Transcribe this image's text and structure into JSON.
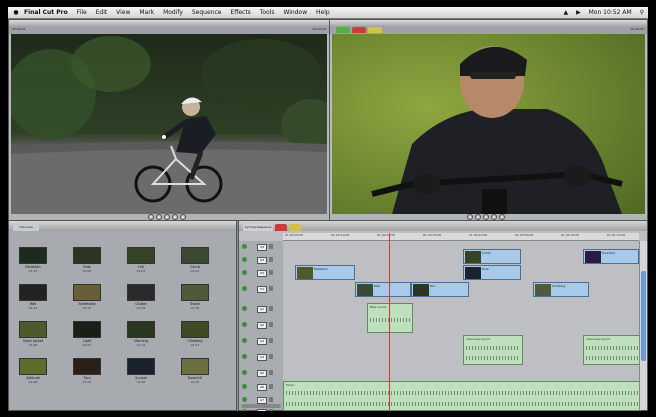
{
  "menubar": {
    "apple": "",
    "items": [
      "Final Cut Pro",
      "File",
      "Edit",
      "View",
      "Mark",
      "Modify",
      "Sequence",
      "Effects",
      "Tools",
      "Window",
      "Help"
    ],
    "clock": "Mon 10:52 AM"
  },
  "viewer_left": {
    "timecode_left": "00:00:01",
    "timecode_right": "00:00:09"
  },
  "canvas_right": {
    "timecode_left": "00:00:04",
    "timecode_right": "00:00:02"
  },
  "browser": {
    "tab_label": "Interview",
    "clips": [
      {
        "name": "Establish",
        "dur": "01:13"
      },
      {
        "name": "Ride",
        "dur": "01:05"
      },
      {
        "name": "Hill",
        "dur": "01:02"
      },
      {
        "name": "Climb",
        "dur": "01:01"
      },
      {
        "name": "Wet",
        "dur": "01:03"
      },
      {
        "name": "Streetside",
        "dur": "01:12"
      },
      {
        "name": "Clutter",
        "dur": "01:03"
      },
      {
        "name": "Travel",
        "dur": "01:08"
      },
      {
        "name": "Open Jacket",
        "dur": "01:08"
      },
      {
        "name": "Light",
        "dur": "01:01"
      },
      {
        "name": "Morning",
        "dur": "01:12"
      },
      {
        "name": "Climbing",
        "dur": "01:07"
      },
      {
        "name": "Attitude",
        "dur": "01:08"
      },
      {
        "name": "Turn",
        "dur": "01:02"
      },
      {
        "name": "Sunset",
        "dur": "01:08"
      },
      {
        "name": "Downhill",
        "dur": "01:10"
      }
    ]
  },
  "timeline": {
    "title": "Cycling Sequence",
    "ruler": [
      "01:00:00:00",
      "01:00:10:00",
      "01:00:20:00",
      "01:00:30:00",
      "01:00:40:00",
      "01:00:50:00",
      "01:01:00:00",
      "01:01:10:00"
    ],
    "tracks": [
      "V4",
      "V3",
      "V2",
      "V1",
      "A1",
      "A2",
      "A3",
      "A4",
      "A5",
      "A6",
      "A7",
      "A8"
    ],
    "video_clips": [
      "Establish",
      "Wet",
      "Climb",
      "Ride",
      "Hill",
      "Downhill",
      "Climbing"
    ],
    "audio_clips": [
      "Bike sound",
      "Bike sound",
      "Interview sound",
      "Interview sound",
      "Music"
    ]
  },
  "colors": {
    "accent": "#6a9bd8",
    "video_clip": "#a9c9e8",
    "audio_clip": "#bfe0be",
    "playhead": "#dd3333"
  }
}
